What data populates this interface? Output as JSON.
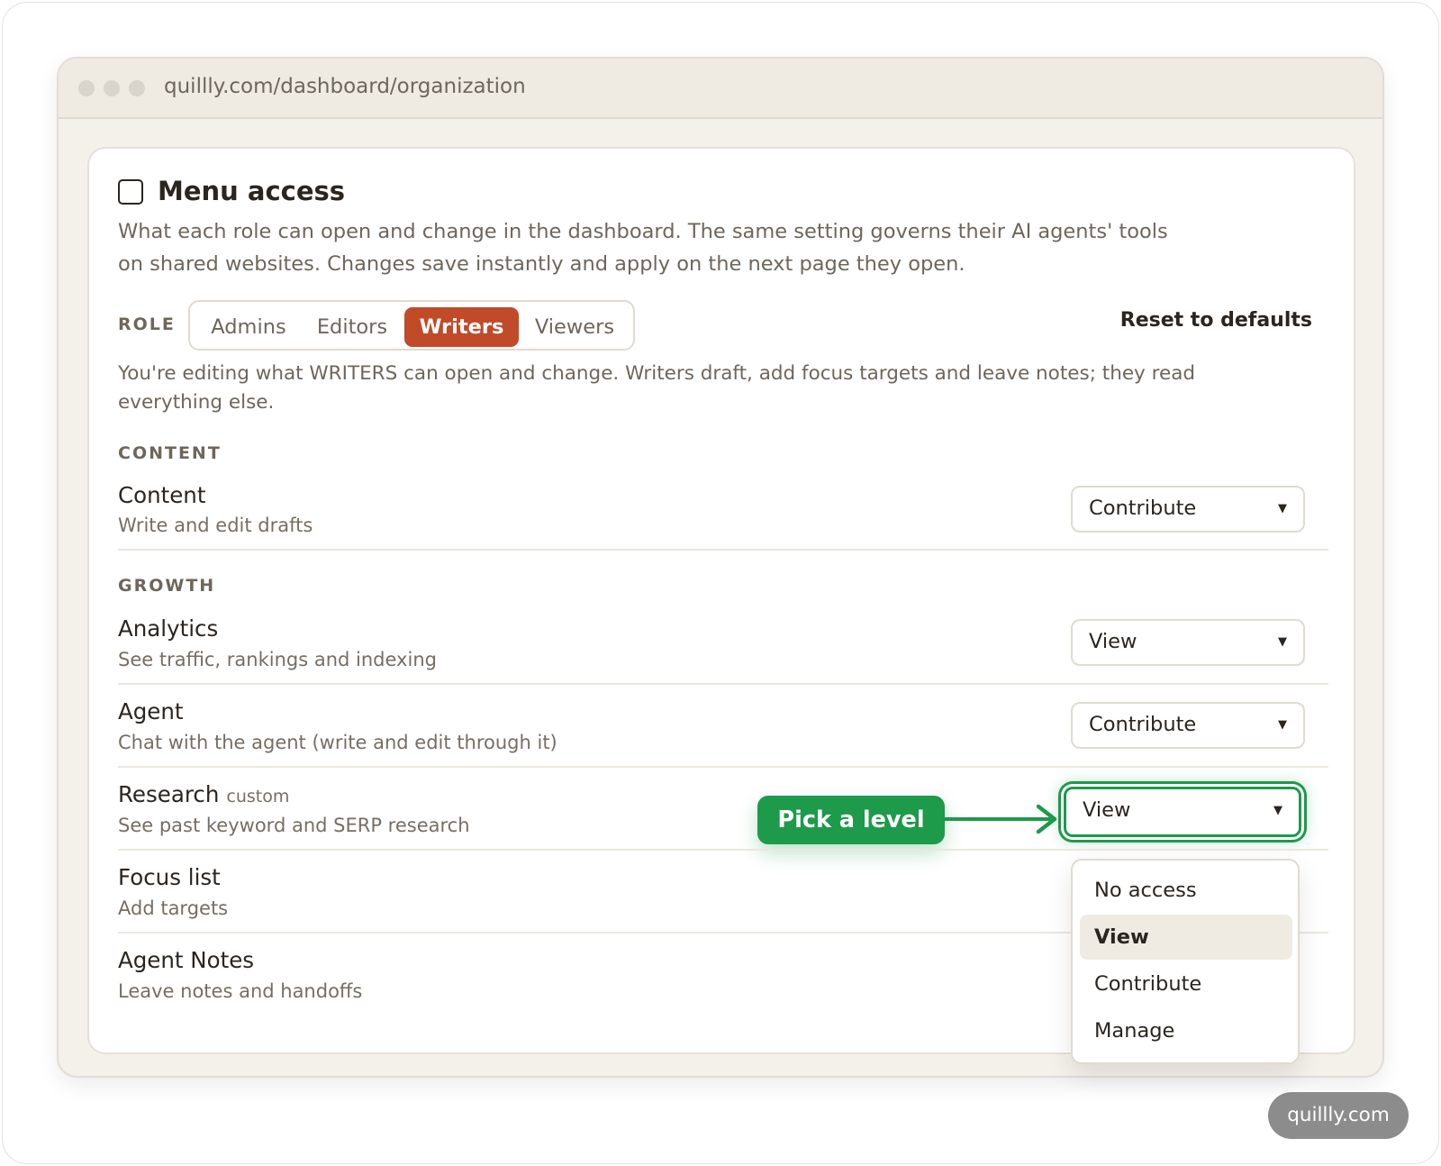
{
  "browser": {
    "url": "quillly.com/dashboard/organization"
  },
  "header": {
    "title": "Menu access",
    "description": "What each role can open and change in the dashboard. The same setting governs their AI agents' tools on shared websites. Changes save instantly and apply on the next page they open."
  },
  "roles": {
    "label": "ROLE",
    "tabs": [
      "Admins",
      "Editors",
      "Writers",
      "Viewers"
    ],
    "active": "Writers",
    "reset_label": "Reset to defaults"
  },
  "hint": "You're editing what WRITERS can open and change. Writers draft, add focus targets and leave notes; they read everything else.",
  "sections": {
    "content": "CONTENT",
    "growth": "GROWTH"
  },
  "rows": [
    {
      "title": "Content",
      "subtitle": "Write and edit drafts",
      "level": "Contribute"
    },
    {
      "title": "Analytics",
      "subtitle": "See traffic, rankings and indexing",
      "level": "View"
    },
    {
      "title": "Agent",
      "subtitle": "Chat with the agent (write and edit through it)",
      "level": "Contribute"
    },
    {
      "title": "Research",
      "tag": "custom",
      "subtitle": "See past keyword and SERP research",
      "level": "View"
    },
    {
      "title": "Focus list",
      "subtitle": "Add targets"
    },
    {
      "title": "Agent Notes",
      "subtitle": "Leave notes and handoffs"
    }
  ],
  "callout": {
    "label": "Pick a level",
    "color": "#1d9a4a"
  },
  "dropdown": {
    "options": [
      "No access",
      "View",
      "Contribute",
      "Manage"
    ],
    "selected": "View"
  },
  "watermark": "quillly.com",
  "colors": {
    "accent": "#c14a28",
    "highlight": "#1d9a4a"
  }
}
